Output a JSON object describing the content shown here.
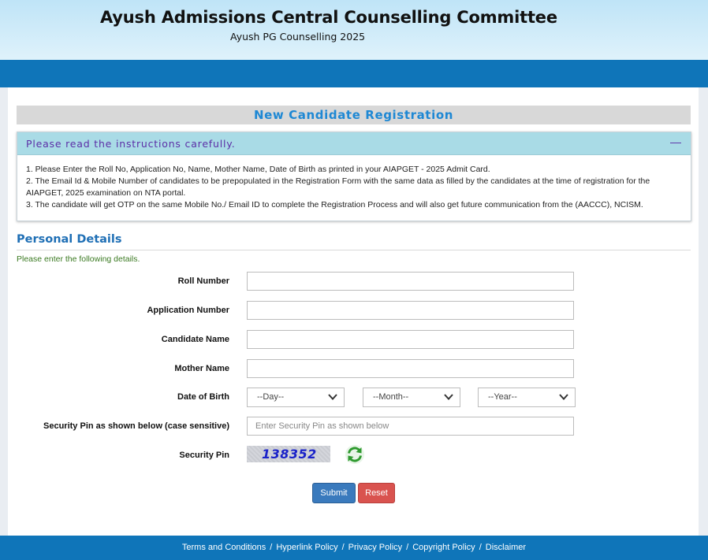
{
  "header": {
    "title": "Ayush Admissions Central Counselling Committee",
    "subtitle": "Ayush PG Counselling 2025"
  },
  "page": {
    "heading": "New Candidate Registration"
  },
  "instructions": {
    "title": "Please read the instructions carefully.",
    "collapse_symbol": "—",
    "items": [
      "1. Please Enter the Roll No, Application No, Name, Mother Name, Date of Birth as printed in your AIAPGET - 2025 Admit Card.",
      "2. The Email Id & Mobile Number of candidates to be prepopulated in the Registration Form with the same data as filled by the candidates at the time of registration for the AIAPGET, 2025 examination on NTA portal.",
      "3. The candidate will get OTP on the same Mobile No./ Email ID to complete the Registration Process and will also get future communication from the (AACCC), NCISM."
    ]
  },
  "personal": {
    "title": "Personal Details",
    "note": "Please enter the following details."
  },
  "form": {
    "roll_label": "Roll Number",
    "roll_value": "",
    "app_label": "Application Number",
    "app_value": "",
    "name_label": "Candidate Name",
    "name_value": "",
    "mother_label": "Mother Name",
    "mother_value": "",
    "dob_label": "Date of Birth",
    "day_selected": "--Day--",
    "month_selected": "--Month--",
    "year_selected": "--Year--",
    "pin_input_label": "Security Pin as shown below (case sensitive)",
    "pin_input_placeholder": "Enter Security Pin as shown below",
    "pin_label": "Security Pin",
    "captcha_text": "138352"
  },
  "buttons": {
    "submit": "Submit",
    "reset": "Reset"
  },
  "footer": {
    "links": [
      "Terms and Conditions",
      "Hyperlink Policy",
      "Privacy Policy",
      "Copyright Policy",
      "Disclaimer"
    ],
    "separator": "/"
  },
  "colors": {
    "brand_blue": "#0f75b9",
    "heading_blue": "#1e88d4",
    "instruction_bg": "#a9dbe6",
    "instruction_text": "#5b2ea6",
    "submit": "#3a7abd",
    "reset": "#d9534f",
    "note_green": "#3b7a22"
  },
  "icons": {
    "collapse": "minus-icon",
    "dropdown": "chevron-down-icon",
    "refresh": "refresh-icon"
  }
}
